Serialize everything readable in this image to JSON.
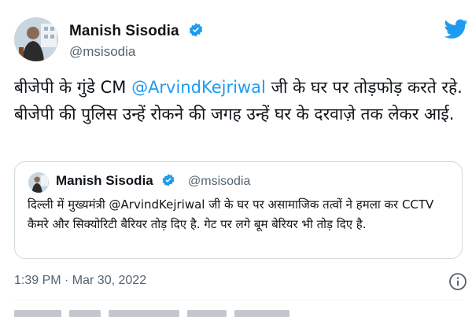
{
  "author": {
    "name": "Manish Sisodia",
    "handle": "@msisodia",
    "verified_icon": "verified-badge-icon",
    "accent_color": "#1d9bf0"
  },
  "tweet": {
    "text_part1": "बीजेपी के गुंडे CM ",
    "mention": "@ArvindKejriwal",
    "text_part2": " जी के घर पर तोड़फोड़ करते रहे. बीजेपी की पुलिस उन्हें रोकने की जगह उन्हें घर के दरवाज़े तक लेकर आई."
  },
  "quoted_tweet": {
    "name": "Manish Sisodia",
    "handle": "@msisodia",
    "text": "दिल्ली में मुख्यमंत्री @ArvindKejriwal जी के घर पर असामाजिक तत्वों ने हमला कर CCTV कैमरे और सिक्योरिटी बैरियर तोड़ दिए है. गेट पर लगे बूम बेरियर भी तोड़ दिए है."
  },
  "meta": {
    "timestamp": "1:39 PM · Mar 30, 2022",
    "info_icon": "info-icon",
    "brand_icon": "twitter-bird-icon"
  }
}
